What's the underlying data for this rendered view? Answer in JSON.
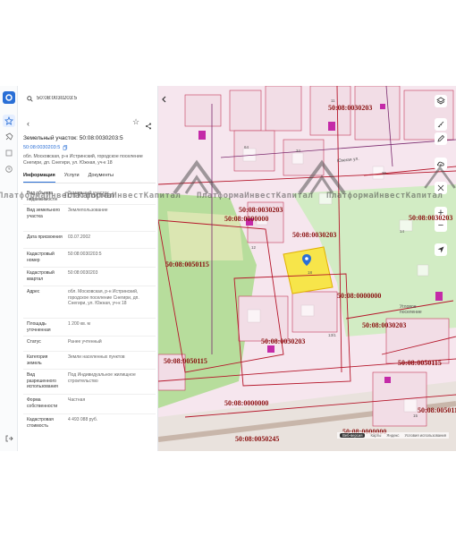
{
  "search": {
    "value": "50:08:0030203:5"
  },
  "header": {
    "title": "Земельный участок: 50:08:0030203:5",
    "cad_number": "50:08:0030203:5",
    "address": "обл. Московская, р-н Истринский, городское поселение Снегири, дп. Снегири, ул. Южная, уч-к 18"
  },
  "tabs": [
    {
      "label": "Информация"
    },
    {
      "label": "Услуги"
    },
    {
      "label": "Документы"
    }
  ],
  "properties": [
    {
      "key": "Вид объекта недвижимости",
      "value": "Земельный участок"
    },
    {
      "key": "Вид земельного участка",
      "value": "Землепользование"
    },
    {
      "key": "Дата присвоения",
      "value": "03.07.2002"
    },
    {
      "key": "Кадастровый номер",
      "value": "50:08:0030203:5"
    },
    {
      "key": "Кадастровый квартал",
      "value": "50:08:0030203"
    },
    {
      "key": "Адрес",
      "value": "обл. Московская, р-н Истринский, городское поселение Снегири, дп. Снегири, ул. Южная, уч-к 18"
    },
    {
      "key": "Площадь уточненная",
      "value": "1 200 кв. м"
    },
    {
      "key": "Статус",
      "value": "Ранее учтенный"
    },
    {
      "key": "Категория земель",
      "value": "Земли населенных пунктов"
    },
    {
      "key": "Вид разрешенного использования",
      "value": "Под Индивидуальное жилищное строительство"
    },
    {
      "key": "Форма собственности",
      "value": "Частная"
    },
    {
      "key": "Кадастровая стоимость",
      "value": "4 493 088 руб."
    }
  ],
  "watermark": "ПлатформаИнвестКапитал",
  "map": {
    "cad_labels": [
      "50:08:0030203",
      "50:08:0000000",
      "50:08:0050115",
      "50:08:0030203",
      "50:08:0050115",
      "50:08:0000000",
      "50:08:0050245",
      "50:08:0030203",
      "50:08:0050115",
      "50:08:0030203",
      "50:08:0000000",
      "50:08:0050115",
      "50:08:0030203",
      "50:08:0030203",
      "50:08:0000000"
    ],
    "small_labels": [
      "11",
      "64",
      "34",
      "12",
      "18",
      "13/1",
      "15",
      "14",
      "36"
    ],
    "streets": [
      "Южная ул.",
      "Угловое поселение"
    ],
    "attribution": {
      "button": "Веб-версия",
      "links": [
        "Карты",
        "Яндекс",
        "Условия использования"
      ]
    }
  },
  "colors": {
    "accent": "#2a6fd6",
    "selected_parcel": "#f7e54a",
    "cad_label": "#8a1010",
    "parcel_line": "#c43a5a"
  }
}
